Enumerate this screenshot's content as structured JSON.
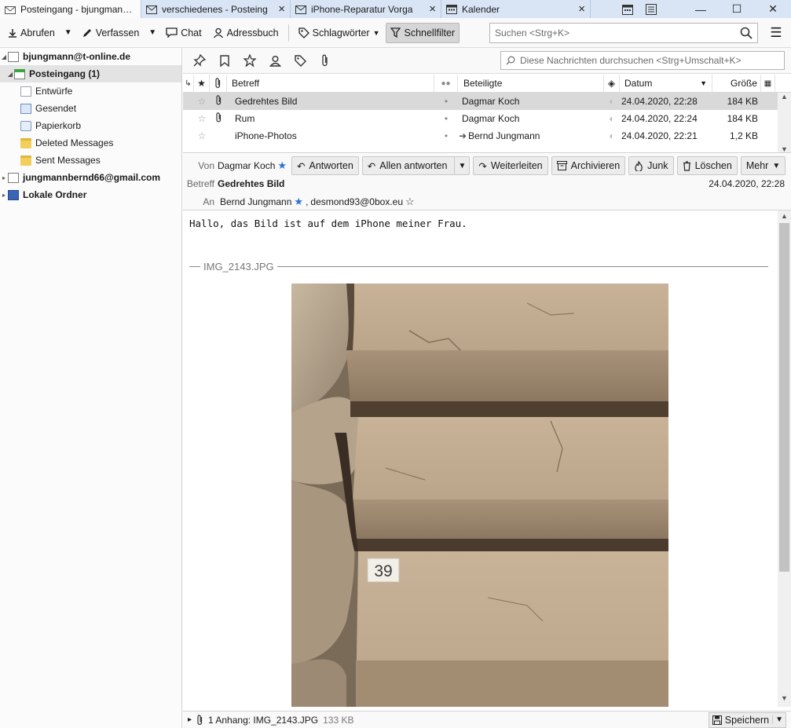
{
  "tabs": [
    {
      "label": "Posteingang - bjungmann@",
      "close": "×",
      "icon": "mail-icon",
      "active": true
    },
    {
      "label": "verschiedenes - Posteing",
      "close": "×",
      "icon": "mail-icon",
      "active": false
    },
    {
      "label": "iPhone-Reparatur Vorga",
      "close": "×",
      "icon": "mail-icon",
      "active": false
    },
    {
      "label": "Kalender",
      "close": "×",
      "icon": "calendar-icon",
      "active": false
    }
  ],
  "toolbar": {
    "get_messages": "Abrufen",
    "write": "Verfassen",
    "chat": "Chat",
    "address_book": "Adressbuch",
    "tags": "Schlagwörter",
    "quick_filter": "Schnellfilter",
    "search_placeholder": "Suchen <Strg+K>"
  },
  "folders": {
    "account1": "bjungmann@t-online.de",
    "inbox": "Posteingang (1)",
    "drafts": "Entwürfe",
    "sent": "Gesendet",
    "trash": "Papierkorb",
    "deleted": "Deleted Messages",
    "sent_messages": "Sent Messages",
    "account2": "jungmannbernd66@gmail.com",
    "local": "Lokale Ordner"
  },
  "quickfilter": {
    "search_placeholder": "Diese Nachrichten durchsuchen <Strg+Umschalt+K>"
  },
  "thread": {
    "columns": {
      "subject": "Betreff",
      "correspondents": "Beteiligte",
      "date": "Datum",
      "size": "Größe"
    },
    "rows": [
      {
        "subject": "Gedrehtes Bild",
        "correspondent": "Dagmar Koch",
        "date": "24.04.2020, 22:28",
        "size": "184 KB",
        "attachment": true,
        "selected": true
      },
      {
        "subject": "Rum",
        "correspondent": "Dagmar Koch",
        "date": "24.04.2020, 22:24",
        "size": "184 KB",
        "attachment": true,
        "selected": false
      },
      {
        "subject": "iPhone-Photos",
        "correspondent": "Bernd Jungmann",
        "date": "24.04.2020, 22:21",
        "size": "1,2 KB",
        "attachment": false,
        "selected": false
      }
    ]
  },
  "message": {
    "from_label": "Von",
    "from": "Dagmar Koch",
    "subject_label": "Betreff",
    "subject": "Gedrehtes Bild",
    "date": "24.04.2020, 22:28",
    "to_label": "An",
    "to1": "Bernd Jungmann",
    "to2": "desmond93@0box.eu",
    "actions": {
      "reply": "Antworten",
      "reply_all": "Allen antworten",
      "forward": "Weiterleiten",
      "archive": "Archivieren",
      "junk": "Junk",
      "delete": "Löschen",
      "more": "Mehr"
    },
    "body": "Hallo, das Bild ist auf dem iPhone meiner Frau.",
    "attachment_name": "IMG_2143.JPG",
    "step_number": "39"
  },
  "attachment_bar": {
    "label": "1 Anhang: IMG_2143.JPG",
    "size": "133 KB",
    "save": "Speichern"
  },
  "colors": {
    "tabbar": "#d9e5f5",
    "accent_star": "#2f6fdc",
    "selection": "#d9d9d9"
  }
}
